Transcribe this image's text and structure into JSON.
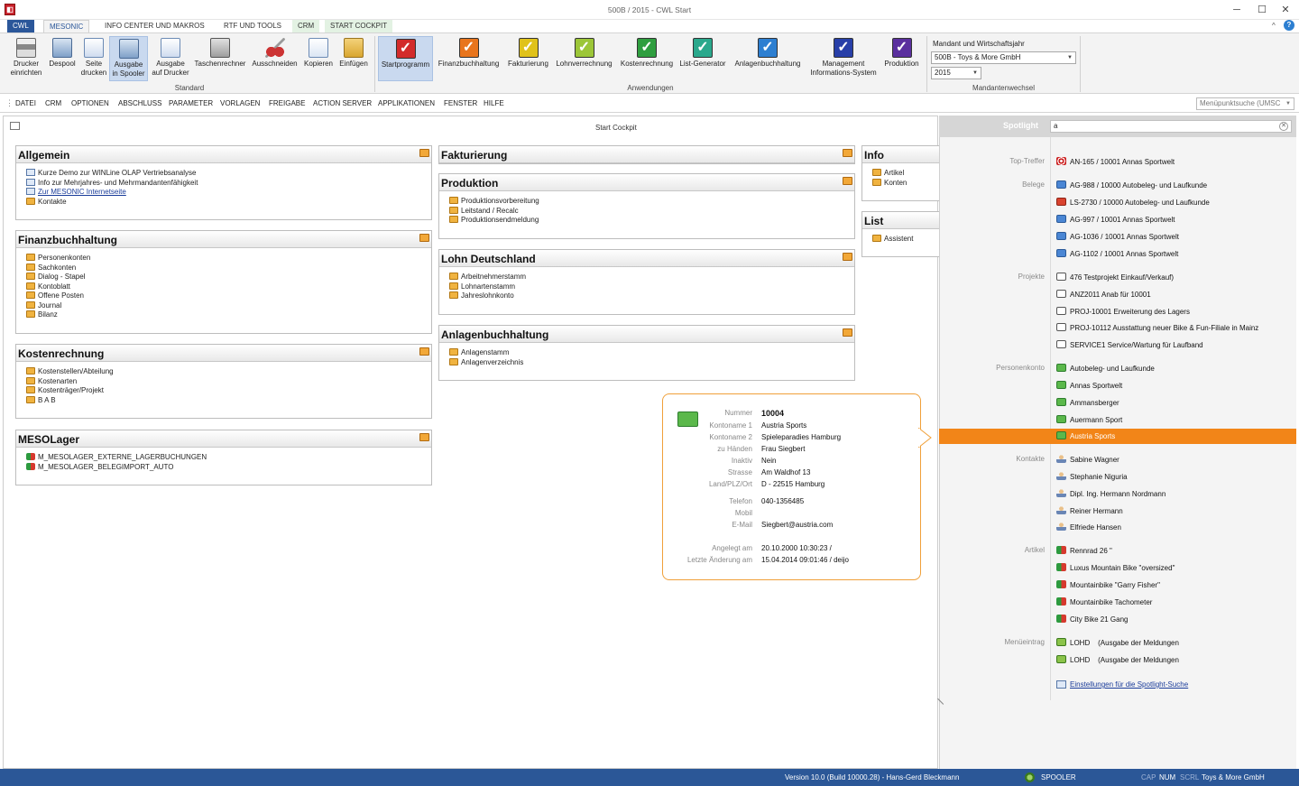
{
  "window": {
    "title": "500B / 2015 - CWL Start",
    "icon": "app-icon",
    "minimize": "─",
    "maximize": "☐",
    "close": "✕",
    "collapse": "^",
    "help": "?"
  },
  "tabs": [
    "CWL",
    "MESONIC",
    "INFO CENTER UND MAKROS",
    "RTF UND TOOLS",
    "CRM",
    "START COCKPIT"
  ],
  "ribbon": {
    "standard": [
      {
        "label1": "Drucker",
        "label2": "einrichten",
        "icon": "printer-icon"
      },
      {
        "label1": "Despool",
        "label2": "",
        "icon": "spool-icon"
      },
      {
        "label1": "Seite",
        "label2": "drucken",
        "icon": "page-print-icon"
      },
      {
        "label1": "Ausgabe",
        "label2": "in Spooler",
        "icon": "spooler-output-icon"
      },
      {
        "label1": "Ausgabe",
        "label2": "auf Drucker",
        "icon": "printer-output-icon"
      },
      {
        "label1": "Taschenrechner",
        "label2": "",
        "icon": "calculator-icon"
      },
      {
        "label1": "Ausschneiden",
        "label2": "",
        "icon": "scissors-icon"
      },
      {
        "label1": "Kopieren",
        "label2": "",
        "icon": "copy-icon"
      },
      {
        "label1": "Einfügen",
        "label2": "",
        "icon": "paste-icon"
      }
    ],
    "standard_group": "Standard",
    "anwendungen": [
      {
        "label1": "Startprogramm",
        "label2": "",
        "icon": "check-red-icon"
      },
      {
        "label1": "Finanzbuchhaltung",
        "label2": "",
        "icon": "check-orange-icon"
      },
      {
        "label1": "Fakturierung",
        "label2": "",
        "icon": "check-yellow-icon"
      },
      {
        "label1": "Lohnverrechnung",
        "label2": "",
        "icon": "check-lime-icon"
      },
      {
        "label1": "Kostenrechnung",
        "label2": "",
        "icon": "check-green-icon"
      },
      {
        "label1": "List-Generator",
        "label2": "",
        "icon": "check-teal-icon"
      },
      {
        "label1": "Anlagenbuchhaltung",
        "label2": "",
        "icon": "check-blue-icon"
      },
      {
        "label1": "Management",
        "label2": "Informations-System",
        "icon": "check-navy-icon"
      },
      {
        "label1": "Produktion",
        "label2": "",
        "icon": "check-purple-icon"
      }
    ],
    "anwendungen_group": "Anwendungen",
    "mandant": {
      "label": "Mandant und Wirtschaftsjahr",
      "company": "500B - Toys & More GmbH",
      "year": "2015",
      "group": "Mandantenwechsel"
    }
  },
  "menu": [
    "DATEI",
    "CRM",
    "OPTIONEN",
    "ABSCHLUSS",
    "PARAMETER",
    "VORLAGEN",
    "FREIGABE",
    "ACTION SERVER",
    "APPLIKATIONEN",
    "FENSTER",
    "HILFE"
  ],
  "menu_search": "Menüpunktsuche (UMSC",
  "cockpit_title": "Start Cockpit",
  "cards": {
    "allgemein": {
      "title": "Allgemein",
      "items": [
        "Kurze Demo zur WINLine OLAP Vertriebsanalyse",
        "Info zur Mehrjahres- und Mehrmandantenfähigkeit",
        "Zur MESONIC Internetseite",
        "Kontakte"
      ]
    },
    "finanz": {
      "title": "Finanzbuchhaltung",
      "items": [
        "Personenkonten",
        "Sachkonten",
        "Dialog - Stapel",
        "Kontoblatt",
        "Offene Posten",
        "Journal",
        "Bilanz"
      ]
    },
    "kosten": {
      "title": "Kostenrechnung",
      "items": [
        "Kostenstellen/Abteilung",
        "Kostenarten",
        "Kostenträger/Projekt",
        "B A B"
      ]
    },
    "meso": {
      "title": "MESOLager",
      "items": [
        "M_MESOLAGER_EXTERNE_LAGERBUCHUNGEN",
        "M_MESOLAGER_BELEGIMPORT_AUTO"
      ]
    },
    "faktur": {
      "title": "Fakturierung",
      "items": []
    },
    "prod": {
      "title": "Produktion",
      "items": [
        "Produktionsvorbereitung",
        "Leitstand / Recalc",
        "Produktionsendmeldung"
      ]
    },
    "lohn": {
      "title": "Lohn Deutschland",
      "items": [
        "Arbeitnehmerstamm",
        "Lohnartenstamm",
        "Jahreslohnkonto"
      ]
    },
    "anlagen": {
      "title": "Anlagenbuchhaltung",
      "items": [
        "Anlagenstamm",
        "Anlagenverzeichnis"
      ]
    },
    "info": {
      "title": "Info",
      "items": [
        "Artikel",
        "Konten"
      ]
    },
    "list": {
      "title": "List",
      "items": [
        "Assistent"
      ]
    }
  },
  "popup": {
    "rows": [
      {
        "label": "Nummer",
        "value": "10004"
      },
      {
        "label": "Kontoname 1",
        "value": "Austria Sports"
      },
      {
        "label": "Kontoname 2",
        "value": "Spieleparadies Hamburg"
      },
      {
        "label": "zu Händen",
        "value": "Frau Siegbert"
      },
      {
        "label": "Inaktiv",
        "value": "Nein"
      },
      {
        "label": "Strasse",
        "value": "Am Waldhof 13"
      },
      {
        "label": "Land/PLZ/Ort",
        "value": "D - 22515 Hamburg"
      },
      {
        "label": "Telefon",
        "value": "040-1356485"
      },
      {
        "label": "Mobil",
        "value": ""
      },
      {
        "label": "E-Mail",
        "value": "Siegbert@austria.com"
      },
      {
        "label": "Angelegt am",
        "value": "20.10.2000 10:30:23 /"
      },
      {
        "label": "Letzte Änderung am",
        "value": "15.04.2014 09:01:46 / deijo"
      }
    ]
  },
  "spotlight": {
    "label": "Spotlight",
    "query": "a",
    "categories": {
      "top": "Top-Treffer",
      "belege": "Belege",
      "projekte": "Projekte",
      "personen": "Personenkonto",
      "kontakte": "Kontakte",
      "artikel": "Artikel",
      "menu": "Menüeintrag"
    },
    "top": [
      "AN-165 / 10001 Annas Sportwelt"
    ],
    "belege": [
      "AG-988 / 10000 Autobeleg- und Laufkunde",
      "LS-2730 / 10000 Autobeleg- und Laufkunde",
      "AG-997 / 10001 Annas Sportwelt",
      "AG-1036 / 10001 Annas Sportwelt",
      "AG-1102 / 10001 Annas Sportwelt"
    ],
    "projekte": [
      "476 Testprojekt Einkauf/Verkauf)",
      "ANZ2011 Anab für 10001",
      "PROJ-10001 Erweiterung des Lagers",
      "PROJ-10112 Ausstattung neuer Bike & Fun-Filiale in Mainz",
      "SERVICE1 Service/Wartung für Laufband"
    ],
    "personen": [
      "Autobeleg- und Laufkunde",
      "Annas Sportwelt",
      "Ammansberger",
      "Auermann Sport",
      "Austria Sports"
    ],
    "kontakte": [
      "Sabine Wagner",
      "Stephanie Niguria",
      "Dipl. Ing. Hermann Nordmann",
      "Reiner Hermann",
      "Elfriede Hansen"
    ],
    "artikel": [
      "Rennrad 26 \"",
      "Luxus Mountain Bike \"oversized\"",
      "Mountainbike \"Garry Fisher\"",
      "Mountainbike Tachometer",
      "City Bike 21 Gang"
    ],
    "menu": [
      "LOHD    (Ausgabe der Meldungen",
      "LOHD    (Ausgabe der Meldungen"
    ],
    "settings_link": "Einstellungen für die Spotlight-Suche",
    "selected": "Austria Sports"
  },
  "status": {
    "version": "Version 10.0 (Build 10000.28) - Hans-Gerd Bleckmann",
    "spooler": "SPOOLER",
    "cap": "CAP",
    "num": "NUM",
    "scrl": "SCRL",
    "company": "Toys & More GmbH"
  },
  "colors": {
    "accent": "#2b579a",
    "orange": "#f28518",
    "status": "#2b5797"
  }
}
